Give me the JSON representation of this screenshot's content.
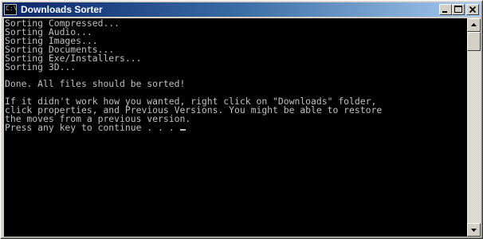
{
  "window": {
    "title": "Downloads Sorter",
    "icon": "console-icon",
    "icon_text": "C:\\"
  },
  "caption_buttons": {
    "minimize": "minimize-icon",
    "maximize": "maximize-icon",
    "close": "close-icon"
  },
  "console": {
    "lines": [
      "Sorting Compressed...",
      "Sorting Audio...",
      "Sorting Images...",
      "Sorting Documents...",
      "Sorting Exe/Installers...",
      "Sorting 3D...",
      "",
      "Done. All files should be sorted!",
      "",
      "If it didn't work how you wanted, right click on \"Downloads\" folder,",
      "click properties, and Previous Versions. You might be able to restore",
      "the moves from a previous version.",
      "Press any key to continue . . . "
    ],
    "foreground": "#c0c0c0",
    "background": "#000000"
  },
  "colors": {
    "titlebar_start": "#0a246a",
    "titlebar_end": "#a6caf0",
    "chrome": "#d4d0c8"
  }
}
